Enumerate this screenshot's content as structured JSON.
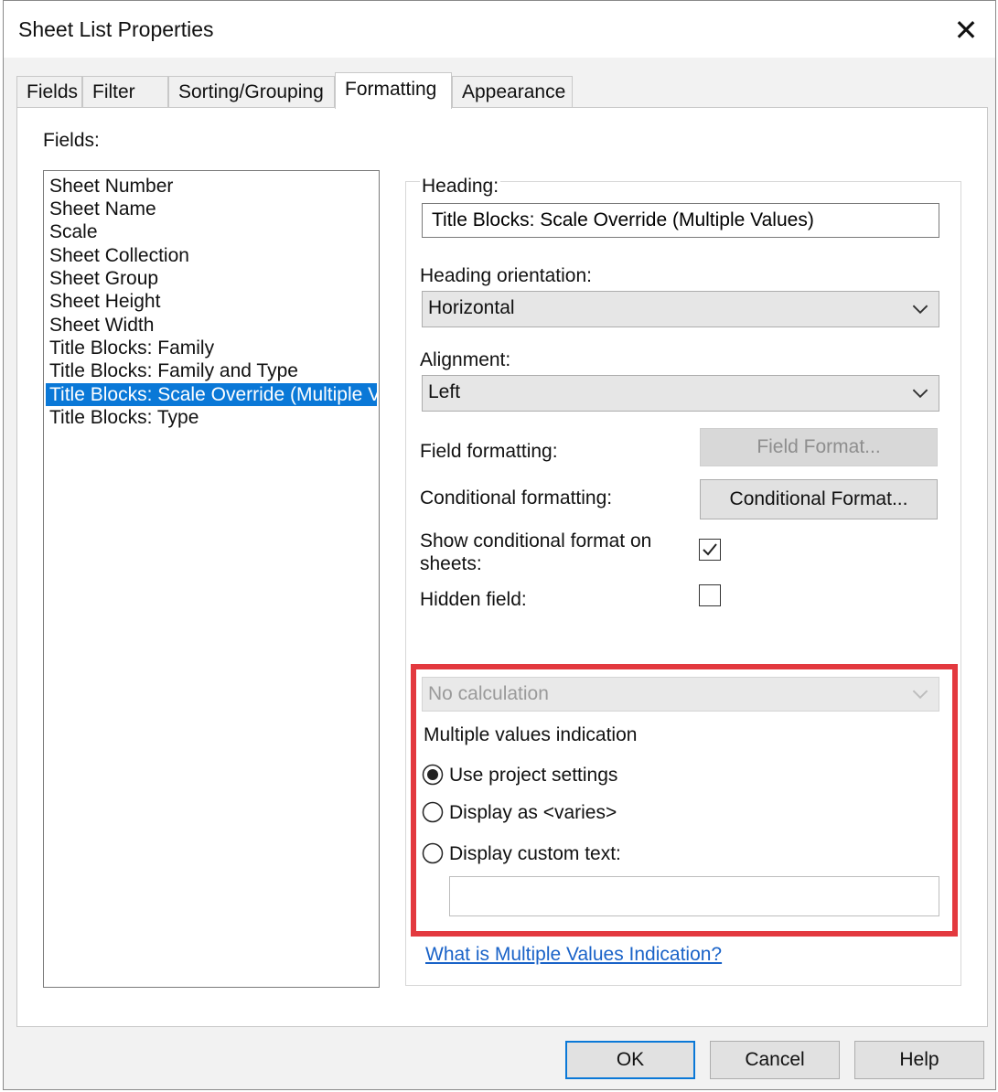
{
  "dialog": {
    "title": "Sheet List Properties",
    "close_symbol": "✕"
  },
  "tabs": [
    {
      "label": "Fields"
    },
    {
      "label": "Filter"
    },
    {
      "label": "Sorting/Grouping"
    },
    {
      "label": "Formatting",
      "active": true
    },
    {
      "label": "Appearance"
    }
  ],
  "fields": {
    "label": "Fields:",
    "items": [
      {
        "label": "Sheet Number"
      },
      {
        "label": "Sheet Name"
      },
      {
        "label": "Scale"
      },
      {
        "label": "Sheet Collection"
      },
      {
        "label": "Sheet Group"
      },
      {
        "label": "Sheet Height"
      },
      {
        "label": "Sheet Width"
      },
      {
        "label": "Title Blocks: Family"
      },
      {
        "label": "Title Blocks: Family and Type"
      },
      {
        "label": "Title Blocks: Scale Override (Multiple Values)",
        "selected": true
      },
      {
        "label": "Title Blocks: Type"
      }
    ]
  },
  "formatting": {
    "heading_label": "Heading:",
    "heading_value": "Title Blocks: Scale Override (Multiple Values)",
    "orientation_label": "Heading orientation:",
    "orientation_value": "Horizontal",
    "alignment_label": "Alignment:",
    "alignment_value": "Left",
    "field_formatting_label": "Field formatting:",
    "field_format_button": "Field Format...",
    "conditional_formatting_label": "Conditional formatting:",
    "conditional_format_button": "Conditional Format...",
    "show_conditional_label_line1": "Show conditional format on",
    "show_conditional_label_line2": "sheets:",
    "show_conditional_checked": true,
    "hidden_field_label": "Hidden field:",
    "hidden_field_checked": false
  },
  "multiple_values": {
    "calculation_value": "No calculation",
    "indication_label": "Multiple values indication",
    "options": [
      {
        "label": "Use project settings",
        "selected": true
      },
      {
        "label": "Display as <varies>",
        "selected": false
      },
      {
        "label": "Display custom text:",
        "selected": false
      }
    ],
    "custom_text_value": "",
    "highlight_color": "#e3393f",
    "help_link": "What is Multiple Values Indication?"
  },
  "footer": {
    "ok": "OK",
    "cancel": "Cancel",
    "help": "Help"
  },
  "colors": {
    "selection": "#0a78d7",
    "link": "#1a63c8"
  }
}
